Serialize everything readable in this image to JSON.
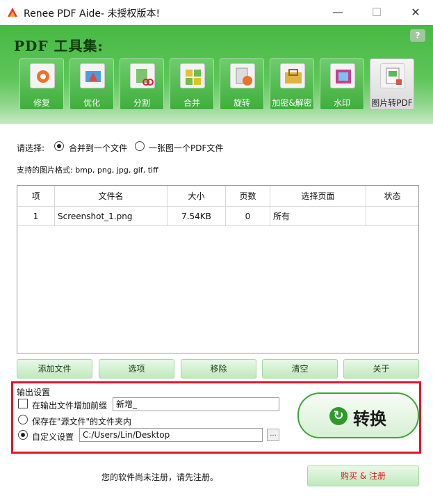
{
  "window": {
    "title": "Renee PDF Aide- 未授权版本!",
    "minimize": "—",
    "maximize": "☐",
    "close": "✕"
  },
  "header": {
    "title": "PDF 工具集:",
    "help_icon": "?",
    "tools": [
      {
        "label": "修复",
        "icon": "repair-icon"
      },
      {
        "label": "优化",
        "icon": "optimize-icon"
      },
      {
        "label": "分割",
        "icon": "split-icon"
      },
      {
        "label": "合并",
        "icon": "merge-icon"
      },
      {
        "label": "旋转",
        "icon": "rotate-icon"
      },
      {
        "label": "加密&解密",
        "icon": "encrypt-icon"
      },
      {
        "label": "水印",
        "icon": "watermark-icon"
      },
      {
        "label": "图片转PDF",
        "icon": "image-to-pdf-icon",
        "active": true
      }
    ]
  },
  "options": {
    "select_label": "请选择:",
    "merge_option": "合并到一个文件",
    "per_image_option": "一张图一个PDF文件",
    "selected": "merge",
    "formats_label": "支持的图片格式: bmp, png, jpg, gif, tiff"
  },
  "table": {
    "columns": [
      "项",
      "文件名",
      "大小",
      "页数",
      "选择页面",
      "状态"
    ],
    "rows": [
      {
        "index": "1",
        "filename": "Screenshot_1.png",
        "size": "7.54KB",
        "pages": "0",
        "page_select": "所有",
        "status": ""
      }
    ]
  },
  "actions": {
    "add_file": "添加文件",
    "options": "选项",
    "remove": "移除",
    "clear": "清空",
    "about": "关于"
  },
  "output": {
    "section_label": "输出设置",
    "prefix_label": "在输出文件增加前缀",
    "prefix_value": "新增_",
    "prefix_checked": false,
    "save_source_label": "保存在\"源文件\"的文件夹内",
    "custom_label": "自定义设置",
    "custom_path": "C:/Users/Lin/Desktop",
    "browse_label": "...",
    "selected": "custom"
  },
  "convert": {
    "label": "转换"
  },
  "footer": {
    "status": "您的软件尚未注册，请先注册。",
    "buy_label": "购买 & 注册"
  },
  "colors": {
    "header_green": "#47b843",
    "highlight_red": "#e0142c",
    "buy_text": "#d11a1a"
  }
}
